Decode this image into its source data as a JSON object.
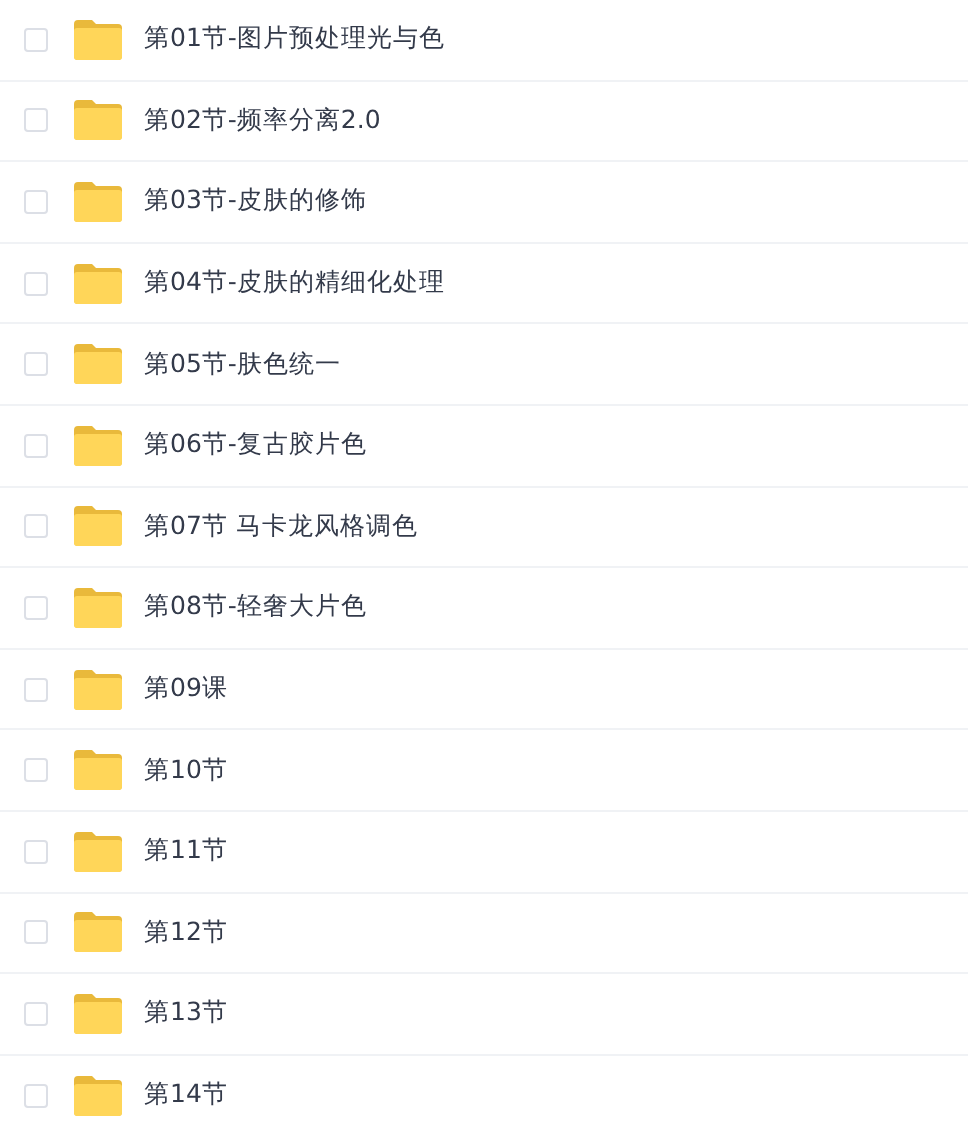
{
  "files": [
    {
      "name": "第01节-图片预处理光与色",
      "checked": false
    },
    {
      "name": "第02节-频率分离2.0",
      "checked": false
    },
    {
      "name": "第03节-皮肤的修饰",
      "checked": false
    },
    {
      "name": "第04节-皮肤的精细化处理",
      "checked": false
    },
    {
      "name": "第05节-肤色统一",
      "checked": false
    },
    {
      "name": "第06节-复古胶片色",
      "checked": false
    },
    {
      "name": "第07节 马卡龙风格调色",
      "checked": false
    },
    {
      "name": "第08节-轻奢大片色",
      "checked": false
    },
    {
      "name": "第09课",
      "checked": false
    },
    {
      "name": "第10节",
      "checked": false
    },
    {
      "name": "第11节",
      "checked": false
    },
    {
      "name": "第12节",
      "checked": false
    },
    {
      "name": "第13节",
      "checked": false
    },
    {
      "name": "第14节",
      "checked": false
    }
  ]
}
